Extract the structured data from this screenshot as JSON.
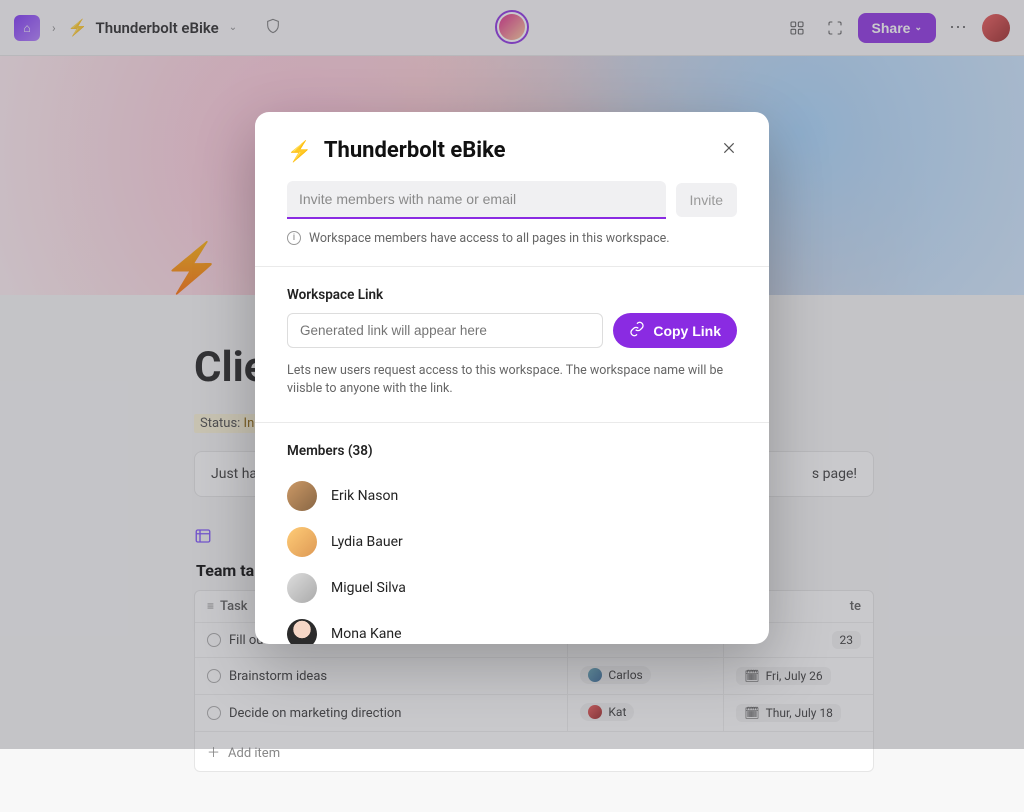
{
  "topbar": {
    "workspace_name": "Thunderbolt eBike",
    "share_label": "Share"
  },
  "page": {
    "title_visible": "Clien",
    "status_prefix": "Status: ",
    "status_value": "In P",
    "callout_visible": "Just had a",
    "callout_right": "s page!",
    "table_title": "Team ta",
    "columns": {
      "task": "Task",
      "date_suffix": "te"
    },
    "rows": [
      {
        "task": "Fill ou",
        "date_suffix": "23"
      },
      {
        "task": "Brainstorm ideas",
        "assignee": "Carlos",
        "date": "Fri, July 26"
      },
      {
        "task": "Decide on marketing direction",
        "assignee": "Kat",
        "date": "Thur, July 18"
      }
    ],
    "add_item": "Add item"
  },
  "modal": {
    "title": "Thunderbolt eBike",
    "invite_placeholder": "Invite members with name or email",
    "invite_button": "Invite",
    "hint": "Workspace members have access to all pages in this workspace.",
    "link_label": "Workspace Link",
    "link_placeholder": "Generated link will appear here",
    "copy_label": "Copy Link",
    "link_desc": "Lets new users request access to this workspace. The workspace name will be viisble to anyone with the link.",
    "members_label": "Members (38)",
    "members": [
      {
        "name": "Erik Nason"
      },
      {
        "name": "Lydia Bauer"
      },
      {
        "name": "Miguel Silva"
      },
      {
        "name": "Mona Kane"
      }
    ]
  }
}
